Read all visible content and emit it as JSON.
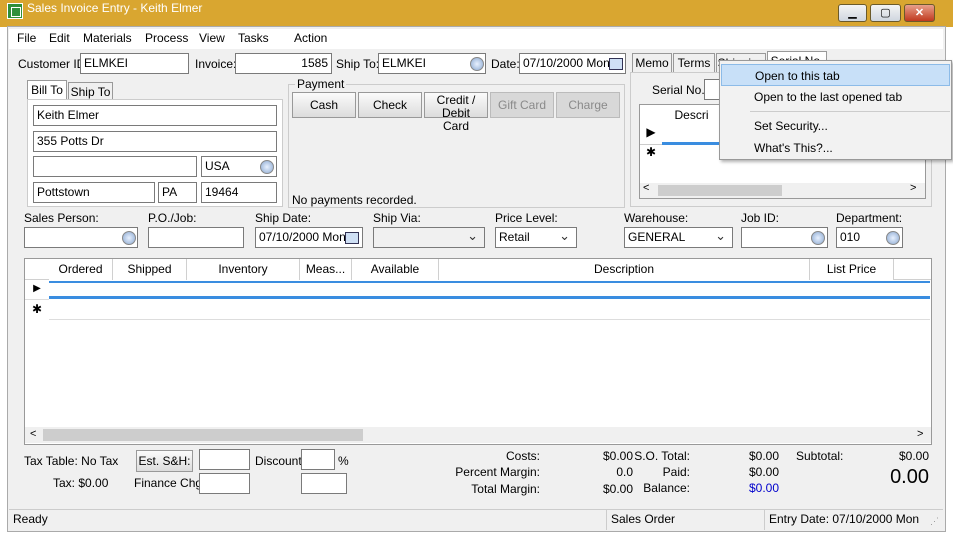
{
  "window": {
    "title": "Sales Invoice Entry - Keith Elmer",
    "minimize": "▁",
    "maximize": "▢",
    "close": "✕"
  },
  "menu": [
    "File",
    "Edit",
    "Materials",
    "Process",
    "View",
    "Tasks",
    "Action"
  ],
  "header": {
    "customer_id_label": "Customer ID:",
    "customer_id": "ELMKEI",
    "invoice_label": "Invoice:",
    "invoice": "1585",
    "ship_to_label": "Ship To:",
    "ship_to": "ELMKEI",
    "date_label": "Date:",
    "date": "07/10/2000 Mon"
  },
  "address_tabs": [
    "Bill To",
    "Ship To"
  ],
  "address": {
    "name": "Keith Elmer",
    "line1": "355 Potts Dr",
    "line2": "",
    "country": "USA",
    "city": "Pottstown",
    "state": "PA",
    "zip": "19464"
  },
  "payment": {
    "title": "Payment",
    "buttons": [
      {
        "label": "Cash"
      },
      {
        "label": "Check"
      },
      {
        "label": "Credit / Debit Card"
      },
      {
        "label": "Gift Card"
      },
      {
        "label": "Charge"
      }
    ],
    "status": "No payments recorded."
  },
  "right_tabs": [
    "Memo",
    "Terms",
    "Shipping",
    "Serial No."
  ],
  "serial": {
    "label": "Serial No.",
    "column": "Descri"
  },
  "context_menu": [
    "Open to this tab",
    "Open to the last opened tab",
    "Set Security...",
    "What's This?..."
  ],
  "row2": {
    "sales_person_label": "Sales Person:",
    "po_job_label": "P.O./Job:",
    "ship_date_label": "Ship Date:",
    "ship_date": "07/10/2000 Mon",
    "ship_via_label": "Ship Via:",
    "price_level_label": "Price Level:",
    "price_level": "Retail",
    "warehouse_label": "Warehouse:",
    "warehouse": "GENERAL",
    "job_id_label": "Job ID:",
    "department_label": "Department:",
    "department": "010"
  },
  "grid": {
    "columns": [
      "Ordered",
      "Shipped",
      "Inventory",
      "Meas...",
      "Available",
      "Description",
      "List Price"
    ]
  },
  "totals": {
    "tax_table": "Tax Table: No Tax",
    "tax": "Tax: $0.00",
    "est_sh": "Est. S&H:",
    "finance_chg": "Finance Chg:",
    "discount_label": "Discount:",
    "percent": "%",
    "costs_label": "Costs:",
    "costs": "$0.00",
    "percent_margin_label": "Percent Margin:",
    "percent_margin": "0.0",
    "total_margin_label": "Total Margin:",
    "total_margin": "$0.00",
    "so_total_label": "S.O. Total:",
    "so_total": "$0.00",
    "paid_label": "Paid:",
    "paid": "$0.00",
    "balance_label": "Balance:",
    "balance": "$0.00",
    "subtotal_label": "Subtotal:",
    "subtotal": "$0.00",
    "grand_total": "0.00"
  },
  "status": {
    "left": "Ready",
    "mode": "Sales Order",
    "entry_date": "Entry Date: 07/10/2000 Mon"
  },
  "colors": {
    "title": "#d9a630",
    "selection": "#3a8de0",
    "balance": "#0000cc"
  }
}
